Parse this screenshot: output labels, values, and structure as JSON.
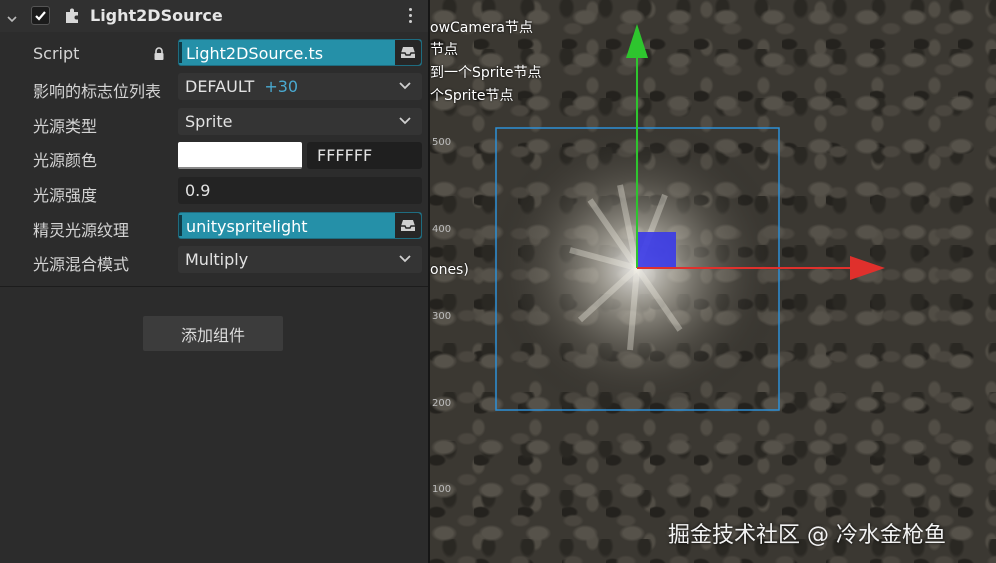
{
  "inspector": {
    "component_title": "Light2DSource",
    "enabled": true,
    "rows": {
      "script": {
        "label": "Script",
        "value": "Light2DSource.ts"
      },
      "layers": {
        "label": "影响的标志位列表",
        "value": "DEFAULT",
        "extra": "+30"
      },
      "light_type": {
        "label": "光源类型",
        "value": "Sprite"
      },
      "light_color": {
        "label": "光源颜色",
        "hex": "FFFFFF",
        "color": "#ffffff"
      },
      "intensity": {
        "label": "光源强度",
        "value": "0.9"
      },
      "sprite_texture": {
        "label": "精灵光源纹理",
        "value": "unityspritelight"
      },
      "blend_mode": {
        "label": "光源混合模式",
        "value": "Multiply"
      }
    },
    "add_component_label": "添加组件"
  },
  "scene": {
    "hints": [
      "owCamera节点",
      "节点",
      "到一个Sprite节点",
      "个Sprite节点",
      "ones)"
    ],
    "ruler_ticks": [
      "500",
      "400",
      "300",
      "200",
      "100"
    ],
    "watermark": "掘金技术社区 @ 冷水金枪鱼"
  },
  "colors": {
    "accent": "#2590a8",
    "gizmo_x": "#e0302c",
    "gizmo_y": "#2ec52e",
    "selection": "#2d8fd6",
    "node_square": "#3a3ae8"
  }
}
